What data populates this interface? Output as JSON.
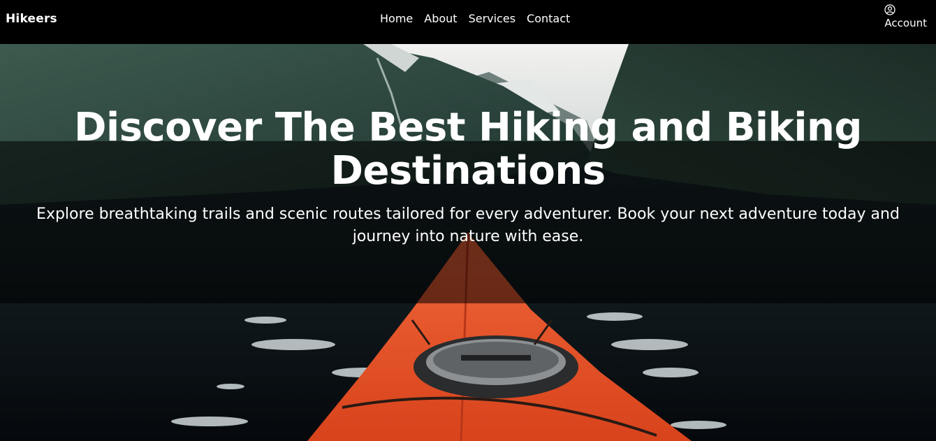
{
  "brand": {
    "name": "Hikeers"
  },
  "nav": {
    "links": [
      {
        "label": "Home"
      },
      {
        "label": "About"
      },
      {
        "label": "Services"
      },
      {
        "label": "Contact"
      }
    ]
  },
  "account": {
    "label": "Account",
    "icon": "user-circle-icon"
  },
  "hero": {
    "title": "Discover The Best Hiking and Biking Destinations",
    "subtitle": "Explore breathtaking trails and scenic routes tailored for every adventurer. Book your next adventure today and journey into nature with ease.",
    "image": "kayak-in-fjord-photo"
  },
  "colors": {
    "navbar_bg": "#000000",
    "text": "#ffffff",
    "kayak": "#e8522a"
  }
}
